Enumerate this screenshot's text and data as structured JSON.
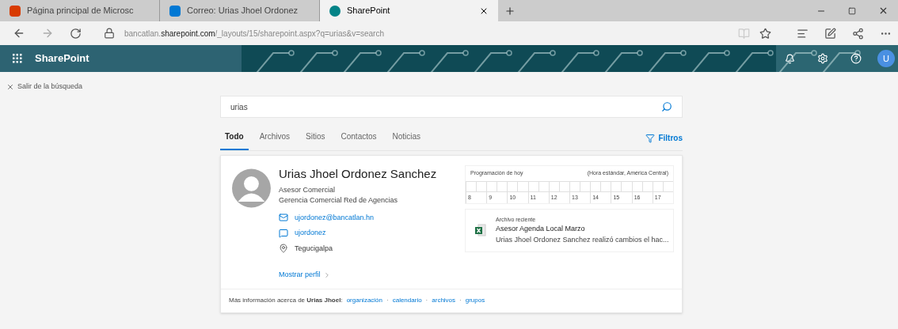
{
  "browser": {
    "tabs": [
      {
        "title": "Página principal de Microsc",
        "selected": false,
        "kind": "office"
      },
      {
        "title": "Correo: Urias Jhoel Ordonez",
        "selected": false,
        "kind": "outlook"
      },
      {
        "title": "SharePoint",
        "selected": true,
        "kind": "sharepoint"
      }
    ],
    "address": {
      "host_prefix": "bancatlan.",
      "host_main": "sharepoint.com",
      "path": "/_layouts/15/sharepoint.aspx?q=urias&v=search"
    }
  },
  "suite_bar": {
    "app_name": "SharePoint",
    "avatar": "U"
  },
  "exit_search": "Salir de la búsqueda",
  "search": {
    "value": "urias"
  },
  "tabs": [
    {
      "label": "Todo",
      "selected": true
    },
    {
      "label": "Archivos",
      "selected": false
    },
    {
      "label": "Sitios",
      "selected": false
    },
    {
      "label": "Contactos",
      "selected": false
    },
    {
      "label": "Noticias",
      "selected": false
    }
  ],
  "filters": "Filtros",
  "person": {
    "name": "Urias Jhoel Ordonez Sanchez",
    "title": "Asesor Comercial",
    "department": "Gerencia Comercial Red de Agencias",
    "contacts": [
      {
        "kind": "email",
        "text": "ujordonez@bancatlan.hn"
      },
      {
        "kind": "chat",
        "text": "ujordonez"
      },
      {
        "kind": "location",
        "text": "Tegucigalpa"
      }
    ],
    "show_profile": "Mostrar perfil",
    "schedule": {
      "title": "Programación de hoy",
      "timezone": "(Hora estándar, América Central)",
      "hours": [
        "8",
        "9",
        "10",
        "11",
        "12",
        "13",
        "14",
        "15",
        "16",
        "17"
      ]
    },
    "recent_file": {
      "label": "Archivo reciente",
      "name": "Asesor Agenda Local Marzo",
      "activity": "Urias Jhoel Ordonez Sanchez realizó cambios el hac..."
    },
    "more_info": {
      "text": "Más información acerca de **Urias Jhoel**:",
      "separator": "·",
      "links": [
        "organización",
        "calendario",
        "archivos",
        "grupos"
      ]
    }
  }
}
